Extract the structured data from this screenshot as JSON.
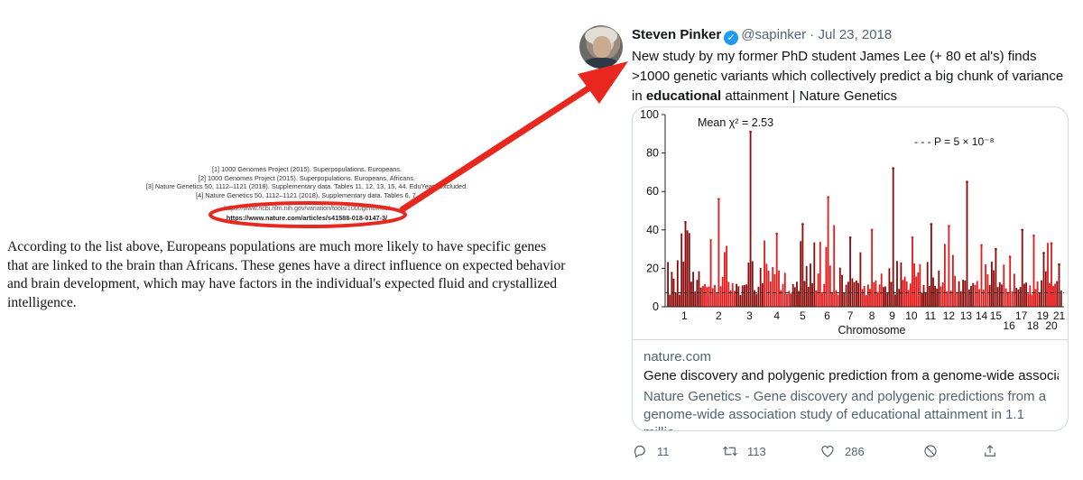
{
  "document": {
    "references": [
      "[1] 1000 Genomes Project (2015). Superpopulations. Europeans.",
      "[2] 1000 Genomes Project (2015). Superpopulations. Europeans, Africans.",
      "[3] Nature Genetics 50, 1112–1121 (2018). Supplementary data. Tables 11, 12, 13, 15, 44. EduYears excluded.",
      "[4] Nature Genetics 50, 1112–1121 (2018). Supplementary data. Tables 6, 7."
    ],
    "url_ncbi": "https://www.ncbi.nlm.nih.gov/variation/tools/1000genomes/",
    "url_nature": "https://www.nature.com/articles/s41588-018-0147-3/",
    "paragraph": "According to the list above, Europeans populations are much more likely to have specific genes that are linked to the brain than Africans. These genes have a direct influence on expected behavior and brain development, which may have factors in the individual's expected fluid and crystallized intelligence."
  },
  "annotation": {
    "color": "#e8281f",
    "arrow_icon": "red-arrow-icon"
  },
  "tweet": {
    "author_name": "Steven Pinker",
    "handle": "@sapinker",
    "date": "Jul 23, 2018",
    "verified_icon": "verified-badge-icon",
    "text_part1": "New study by my former PhD student James Lee (+ 80 et al's) finds >1000 genetic variants which collectively predict a big chunk of variance in ",
    "text_bold": "educational",
    "text_part2": " attainment | Nature Genetics",
    "card": {
      "domain": "nature.com",
      "title": "Gene discovery and polygenic prediction from a genome-wide associa...",
      "description": "Nature Genetics - Gene discovery and polygenic predictions from a genome-wide association study of educational attainment in 1.1 millio..."
    },
    "actions": {
      "reply_count": "11",
      "retweet_count": "113",
      "like_count": "286",
      "reply_icon": "reply-icon",
      "retweet_icon": "retweet-icon",
      "like_icon": "heart-icon",
      "block_icon": "no-sign-icon",
      "share_icon": "share-icon"
    }
  },
  "chart_data": {
    "type": "scatter",
    "subtype": "manhattan",
    "annotation_left": "Mean χ² = 2.53",
    "legend": "P = 5 × 10⁻⁸",
    "xlabel": "Chromosome",
    "ylabel": "",
    "ylim": [
      0,
      100
    ],
    "yticks": [
      0,
      20,
      40,
      60,
      80,
      100
    ],
    "chromosomes": [
      {
        "label": "1",
        "peak": 44
      },
      {
        "label": "2",
        "peak": 56
      },
      {
        "label": "3",
        "peak": 91
      },
      {
        "label": "4",
        "peak": 38
      },
      {
        "label": "5",
        "peak": 43
      },
      {
        "label": "6",
        "peak": 57
      },
      {
        "label": "7",
        "peak": 36
      },
      {
        "label": "8",
        "peak": 40
      },
      {
        "label": "9",
        "peak": 72
      },
      {
        "label": "10",
        "peak": 36
      },
      {
        "label": "11",
        "peak": 43
      },
      {
        "label": "12",
        "peak": 42
      },
      {
        "label": "13",
        "peak": 65
      },
      {
        "label": "14",
        "peak": 32
      },
      {
        "label": "15",
        "peak": 30
      },
      {
        "label": "16",
        "peak": 26
      },
      {
        "label": "17",
        "peak": 40
      },
      {
        "label": "18",
        "peak": 37
      },
      {
        "label": "19",
        "peak": 28
      },
      {
        "label": "20",
        "peak": 33
      },
      {
        "label": "21",
        "peak": 22
      }
    ],
    "threshold": 7.3,
    "colors": [
      "#8b0a0a",
      "#e51a1a"
    ]
  }
}
